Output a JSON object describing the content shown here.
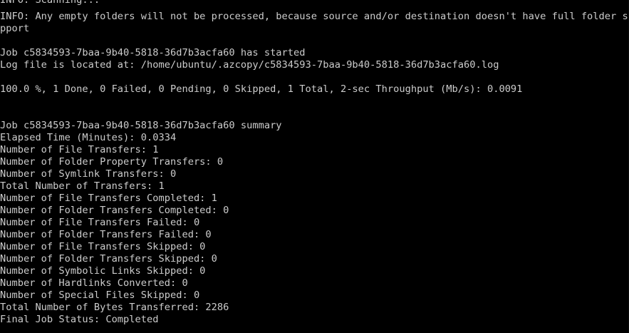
{
  "terminal": {
    "lines": [
      "INFO: Scanning...",
      "INFO: Any empty folders will not be processed, because source and/or destination doesn't have full folder su",
      "pport",
      "",
      "Job c5834593-7baa-9b40-5818-36d7b3acfa60 has started",
      "Log file is located at: /home/ubuntu/.azcopy/c5834593-7baa-9b40-5818-36d7b3acfa60.log",
      "",
      "100.0 %, 1 Done, 0 Failed, 0 Pending, 0 Skipped, 1 Total, 2-sec Throughput (Mb/s): 0.0091",
      "",
      "",
      "Job c5834593-7baa-9b40-5818-36d7b3acfa60 summary",
      "Elapsed Time (Minutes): 0.0334",
      "Number of File Transfers: 1",
      "Number of Folder Property Transfers: 0",
      "Number of Symlink Transfers: 0",
      "Total Number of Transfers: 1",
      "Number of File Transfers Completed: 1",
      "Number of Folder Transfers Completed: 0",
      "Number of File Transfers Failed: 0",
      "Number of Folder Transfers Failed: 0",
      "Number of File Transfers Skipped: 0",
      "Number of Folder Transfers Skipped: 0",
      "Number of Symbolic Links Skipped: 0",
      "Number of Hardlinks Converted: 0",
      "Number of Special Files Skipped: 0",
      "Total Number of Bytes Transferred: 2286",
      "Final Job Status: Completed"
    ],
    "colors": {
      "background": "#000000",
      "foreground": "#cccccc"
    }
  }
}
